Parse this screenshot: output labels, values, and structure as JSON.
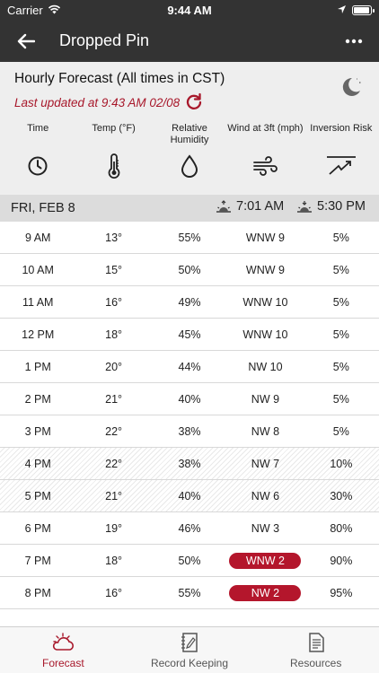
{
  "status_bar": {
    "carrier": "Carrier",
    "time": "9:44 AM",
    "battery_level": 0.95
  },
  "nav": {
    "title": "Dropped Pin"
  },
  "forecast": {
    "title": "Hourly Forecast (All times in CST)",
    "updated": "Last updated at 9:43 AM 02/08",
    "accent_color": "#a8182b",
    "columns": [
      {
        "label": "Time",
        "icon": "clock-icon"
      },
      {
        "label": "Temp (°F)",
        "icon": "thermometer-icon"
      },
      {
        "label": "Relative Humidity",
        "icon": "droplet-icon"
      },
      {
        "label": "Wind at 3ft (mph)",
        "icon": "wind-icon"
      },
      {
        "label": "Inversion Risk",
        "icon": "inversion-icon"
      }
    ]
  },
  "day": {
    "label": "FRI, FEB 8",
    "sunrise": "7:01 AM",
    "sunset": "5:30 PM"
  },
  "rows": [
    {
      "time": "9 AM",
      "temp": "13°",
      "rh": "55%",
      "wind": "WNW 9",
      "risk": "5%"
    },
    {
      "time": "10 AM",
      "temp": "15°",
      "rh": "50%",
      "wind": "WNW 9",
      "risk": "5%"
    },
    {
      "time": "11 AM",
      "temp": "16°",
      "rh": "49%",
      "wind": "WNW 10",
      "risk": "5%"
    },
    {
      "time": "12 PM",
      "temp": "18°",
      "rh": "45%",
      "wind": "WNW 10",
      "risk": "5%"
    },
    {
      "time": "1 PM",
      "temp": "20°",
      "rh": "44%",
      "wind": "NW 10",
      "risk": "5%"
    },
    {
      "time": "2 PM",
      "temp": "21°",
      "rh": "40%",
      "wind": "NW 9",
      "risk": "5%"
    },
    {
      "time": "3 PM",
      "temp": "22°",
      "rh": "38%",
      "wind": "NW 8",
      "risk": "5%"
    },
    {
      "time": "4 PM",
      "temp": "22°",
      "rh": "38%",
      "wind": "NW 7",
      "risk": "10%"
    },
    {
      "time": "5 PM",
      "temp": "21°",
      "rh": "40%",
      "wind": "NW 6",
      "risk": "30%"
    },
    {
      "time": "6 PM",
      "temp": "19°",
      "rh": "46%",
      "wind": "NW 3",
      "risk": "80%"
    },
    {
      "time": "7 PM",
      "temp": "18°",
      "rh": "50%",
      "wind": "WNW 2",
      "risk": "90%"
    },
    {
      "time": "8 PM",
      "temp": "16°",
      "rh": "55%",
      "wind": "NW 2",
      "risk": "95%"
    }
  ],
  "tabs": [
    {
      "label": "Forecast",
      "icon": "cloud-sun-icon",
      "active": true
    },
    {
      "label": "Record Keeping",
      "icon": "notebook-icon",
      "active": false
    },
    {
      "label": "Resources",
      "icon": "document-icon",
      "active": false
    }
  ]
}
